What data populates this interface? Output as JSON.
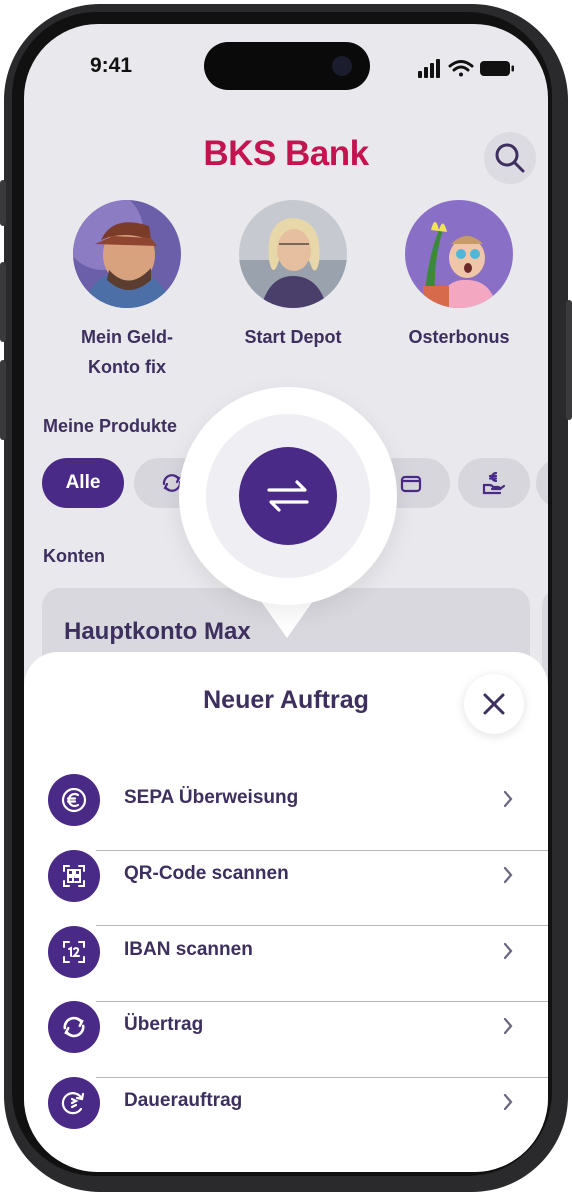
{
  "status_bar": {
    "time": "9:41"
  },
  "header": {
    "logo_text": "BKS Bank",
    "search_icon": "search-icon"
  },
  "stories": [
    {
      "label_line1": "Mein Geld-",
      "label_line2": "Konto fix"
    },
    {
      "label_line1": "Start Depot",
      "label_line2": ""
    },
    {
      "label_line1": "Osterbonus",
      "label_line2": ""
    }
  ],
  "products": {
    "title": "Meine Produkte",
    "chips": [
      {
        "label": "Alle",
        "icon": ""
      },
      {
        "label": "",
        "icon": "transfer-cycle-icon"
      },
      {
        "label": "",
        "icon": "wallet-icon"
      },
      {
        "label": "",
        "icon": "euro-hand-icon"
      },
      {
        "label": "",
        "icon": "people-icon"
      }
    ]
  },
  "accounts": {
    "title": "Konten",
    "card_title": "Hauptkonto Max"
  },
  "fab": {
    "icon": "transfer-arrows-icon"
  },
  "sheet": {
    "title": "Neuer Auftrag",
    "close_icon": "close-icon",
    "items": [
      {
        "label": "SEPA Überweisung",
        "icon": "euro-icon"
      },
      {
        "label": "QR-Code scannen",
        "icon": "qr-code-icon"
      },
      {
        "label": "IBAN scannen",
        "icon": "scan-icon"
      },
      {
        "label": "Übertrag",
        "icon": "transfer-cycle-icon"
      },
      {
        "label": "Dauerauftrag",
        "icon": "recurring-icon"
      }
    ]
  },
  "colors": {
    "brand_red": "#c4144f",
    "primary_purple": "#4a2a87",
    "text_purple": "#3d2f5e",
    "screen_bg": "#e9e8ec"
  }
}
